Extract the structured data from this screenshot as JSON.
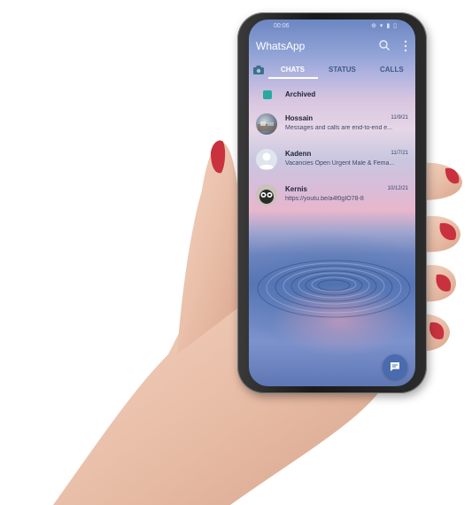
{
  "status_bar": {
    "time": "00:06",
    "icons": "⊕ ▾ ▮ ▯"
  },
  "app": {
    "title": "WhatsApp"
  },
  "tabs": [
    {
      "label": "CHATS",
      "selected": true
    },
    {
      "label": "STATUS",
      "selected": false
    },
    {
      "label": "CALLS",
      "selected": false
    }
  ],
  "archived": {
    "label": "Archived"
  },
  "chats": [
    {
      "name": "Hossain",
      "date": "11/9/21",
      "message": "Messages and calls are end-to-end e..."
    },
    {
      "name": "Kadenn",
      "date": "11/7/21",
      "message": "Vacancies Open Urgent Male & Fema..."
    },
    {
      "name": "Kernis",
      "date": "10/12/21",
      "message": "https://youtu.be/a4f0gIO78-8"
    }
  ],
  "colors": {
    "accent": "#4a6bb0",
    "archive": "#27a9a0",
    "tab_inactive": "#3d5a8a"
  },
  "icons": {
    "appbar": [
      "search-icon",
      "more-vert-icon"
    ],
    "tabs": [
      "camera-icon"
    ],
    "fab": "chat-icon"
  }
}
